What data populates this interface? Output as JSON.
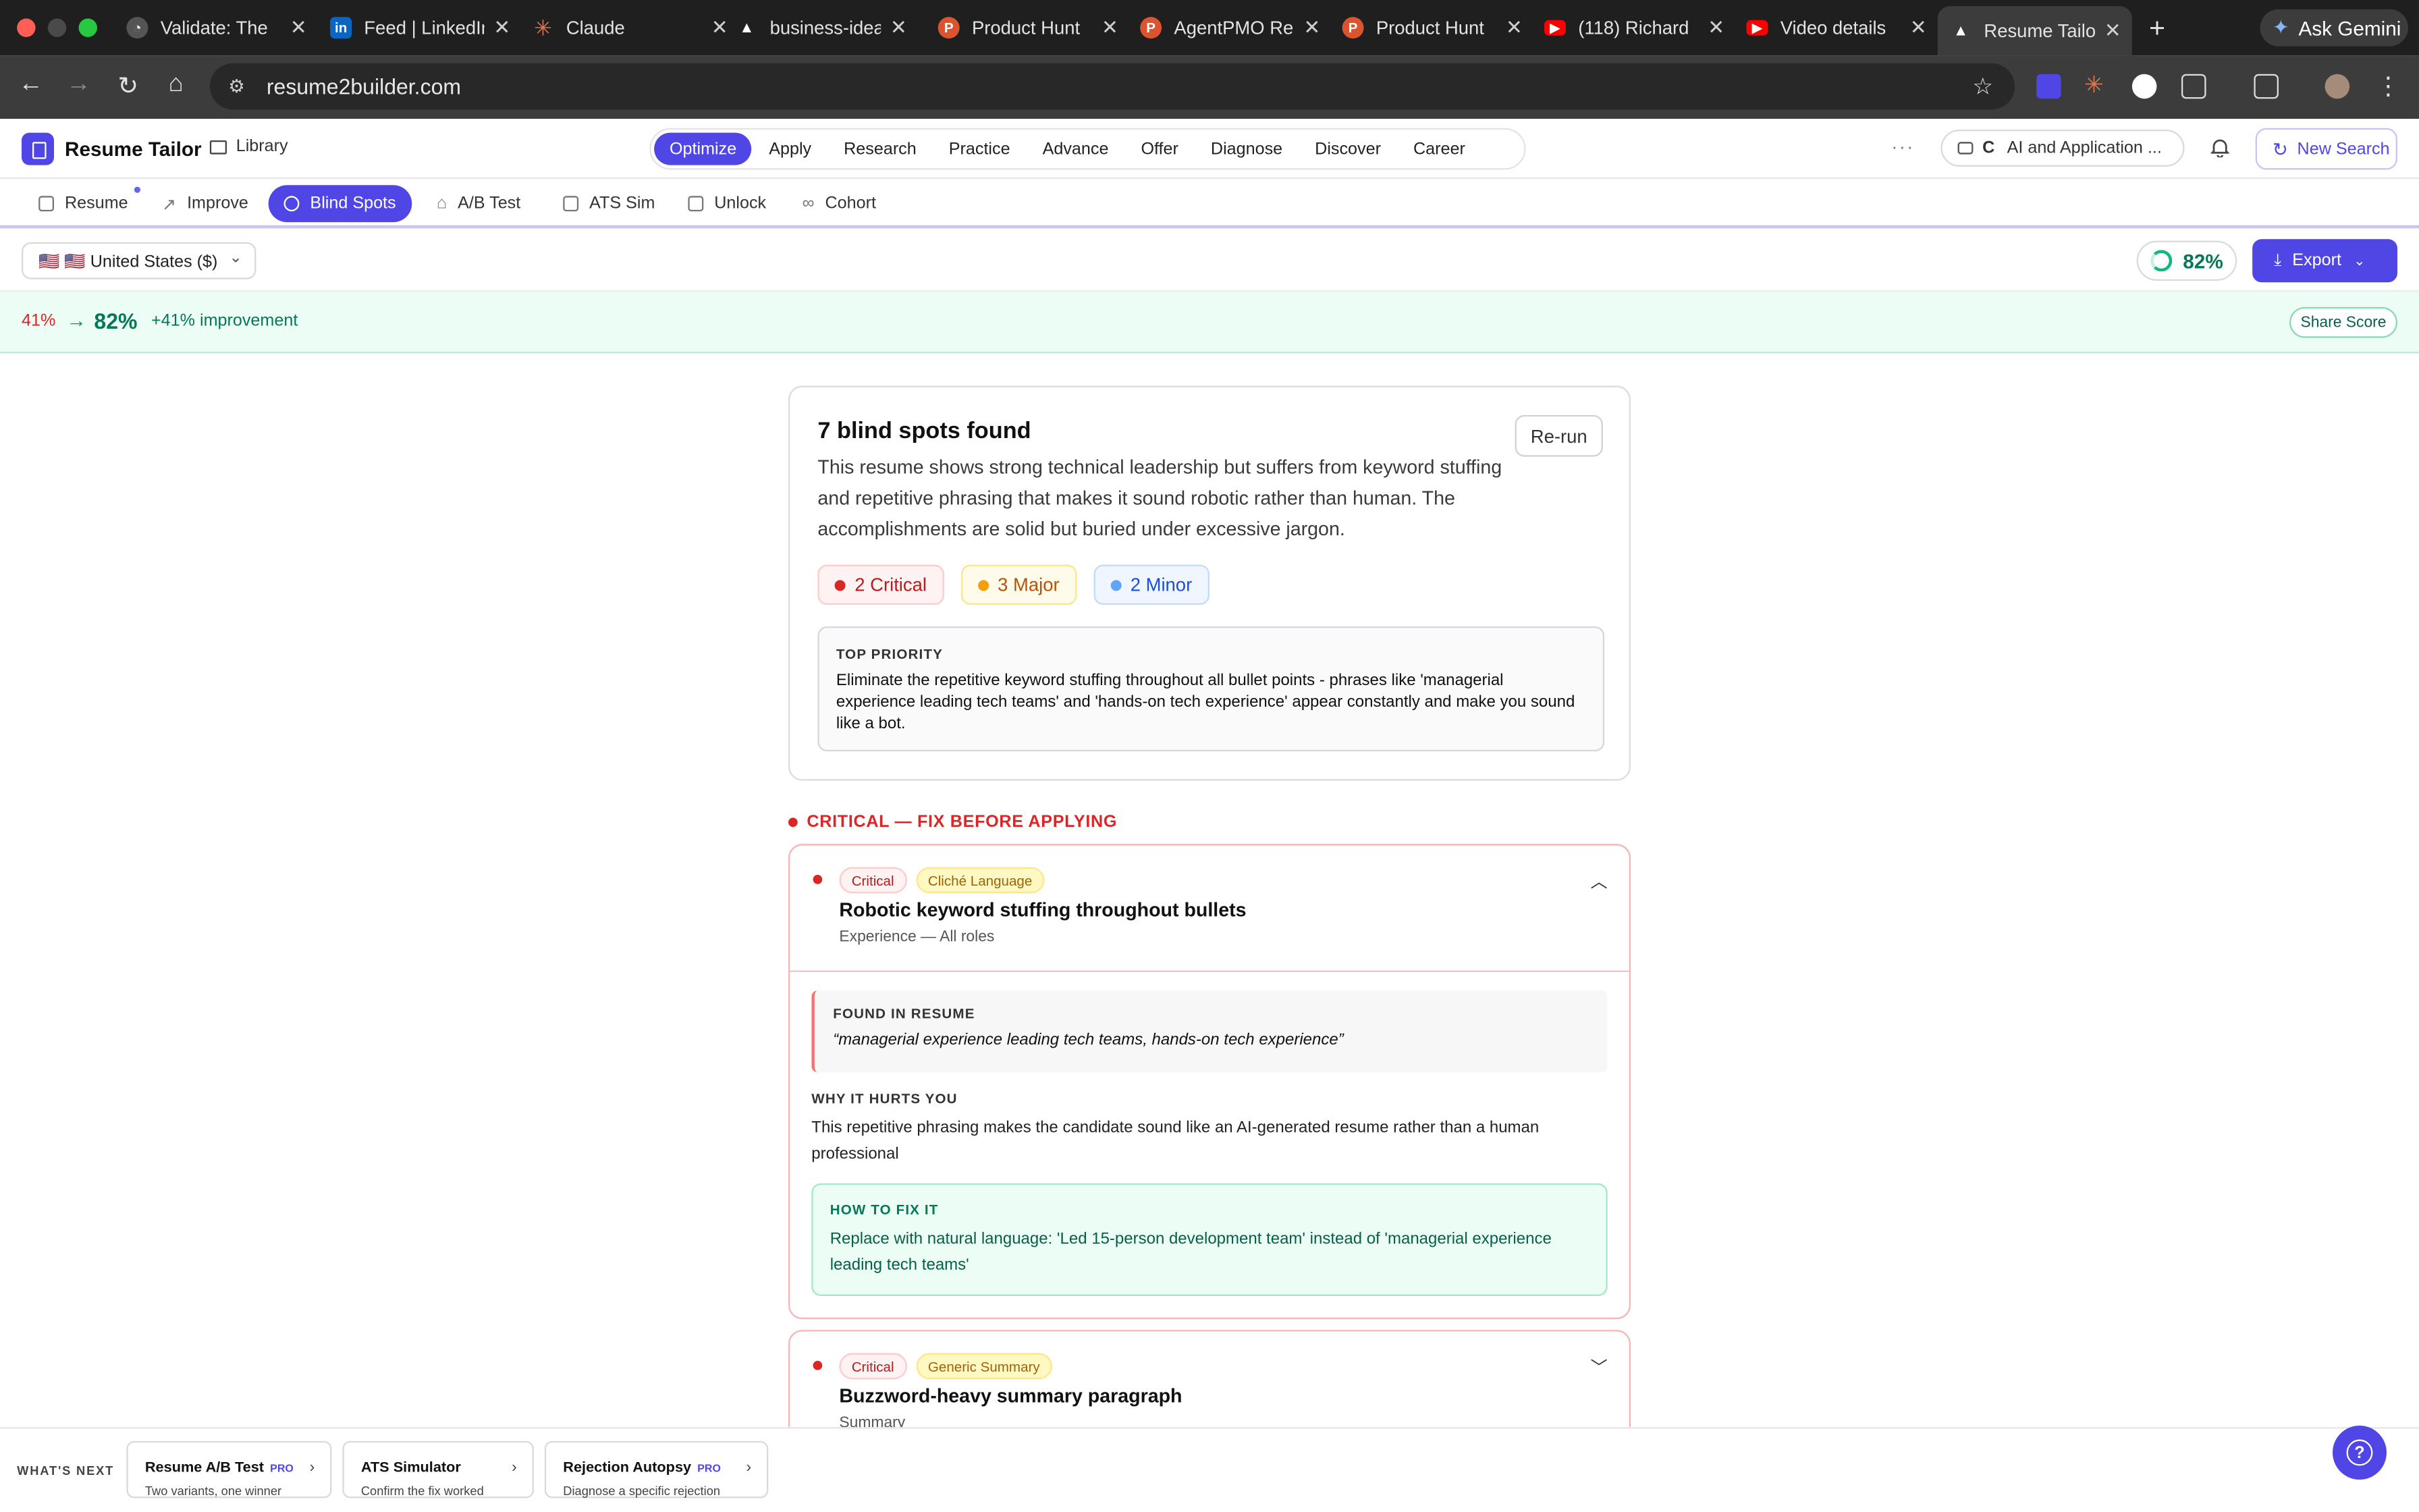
{
  "browser": {
    "tabs": [
      {
        "title": "Validate: The",
        "icon": "validate-icon",
        "color": "#555555"
      },
      {
        "title": "Feed | LinkedIn",
        "icon": "linkedin-icon",
        "color": "#0a66c2"
      },
      {
        "title": "Claude",
        "icon": "claude-icon",
        "color": "#d97757"
      },
      {
        "title": "business-idea",
        "icon": "triangle-icon",
        "color": "#000000"
      },
      {
        "title": "Product Hunt",
        "icon": "producthunt-icon",
        "color": "#da552f"
      },
      {
        "title": "AgentPMO Re",
        "icon": "producthunt-icon",
        "color": "#da552f"
      },
      {
        "title": "Product Hunt",
        "icon": "producthunt-icon",
        "color": "#da552f"
      },
      {
        "title": "(118) Richard",
        "icon": "youtube-icon",
        "color": "#ff0000"
      },
      {
        "title": "Video details",
        "icon": "youtube-icon",
        "color": "#ff0000"
      },
      {
        "title": "Resume Tailor",
        "icon": "triangle-icon",
        "color": "#000000"
      }
    ],
    "ask_gemini": "Ask Gemini",
    "url": "resume2builder.com"
  },
  "app": {
    "brand": "Resume Tailor",
    "library": "Library",
    "main_nav": [
      "Optimize",
      "Apply",
      "Research",
      "Practice",
      "Advance",
      "Offer",
      "Diagnose",
      "Discover",
      "Career"
    ],
    "main_nav_active": 0,
    "context_letter": "C",
    "context_label": "AI and Application ...",
    "new_search": "New Search",
    "accent": "#4f46e5"
  },
  "subnav": {
    "items": [
      "Resume",
      "Improve",
      "Blind Spots",
      "A/B Test",
      "ATS Sim",
      "Unlock",
      "Cohort"
    ],
    "active": 2
  },
  "toolbar": {
    "country": "🇺🇸 🇺🇸 United States ($)",
    "score": "82%",
    "export": "Export"
  },
  "improvement": {
    "before": "41%",
    "after": "82%",
    "delta": "+41% improvement",
    "share": "Share Score"
  },
  "summary": {
    "title": "7 blind spots found",
    "rerun": "Re-run",
    "description": "This resume shows strong technical leadership but suffers from keyword stuffing and repetitive phrasing that makes it sound robotic rather than human. The accomplishments are solid but buried under excessive jargon.",
    "chips": {
      "critical": "2 Critical",
      "major": "3 Major",
      "minor": "2 Minor"
    },
    "priority_label": "TOP PRIORITY",
    "priority_text": "Eliminate the repetitive keyword stuffing throughout all bullet points - phrases like 'managerial experience leading tech teams' and 'hands-on tech experience' appear constantly and make you sound like a bot."
  },
  "section": {
    "heading": "CRITICAL — FIX BEFORE APPLYING"
  },
  "issues": [
    {
      "severity": "Critical",
      "category": "Cliché Language",
      "title": "Robotic keyword stuffing throughout bullets",
      "location": "Experience — All roles",
      "found_label": "FOUND IN RESUME",
      "found": "“managerial experience leading tech teams, hands-on tech experience”",
      "why_label": "WHY IT HURTS YOU",
      "why": "This repetitive phrasing makes the candidate sound like an AI-generated resume rather than a human professional",
      "fix_label": "HOW TO FIX IT",
      "fix": "Replace with natural language: 'Led 15-person development team' instead of 'managerial experience leading tech teams'"
    },
    {
      "severity": "Critical",
      "category": "Generic Summary",
      "title": "Buzzword-heavy summary paragraph",
      "location": "Summary"
    }
  ],
  "whats_next": {
    "label": "WHAT'S NEXT",
    "cards": [
      {
        "title": "Resume A/B Test",
        "pro": "PRO",
        "sub": "Two variants, one winner"
      },
      {
        "title": "ATS Simulator",
        "pro": "",
        "sub": "Confirm the fix worked"
      },
      {
        "title": "Rejection Autopsy",
        "pro": "PRO",
        "sub": "Diagnose a specific rejection"
      }
    ]
  }
}
